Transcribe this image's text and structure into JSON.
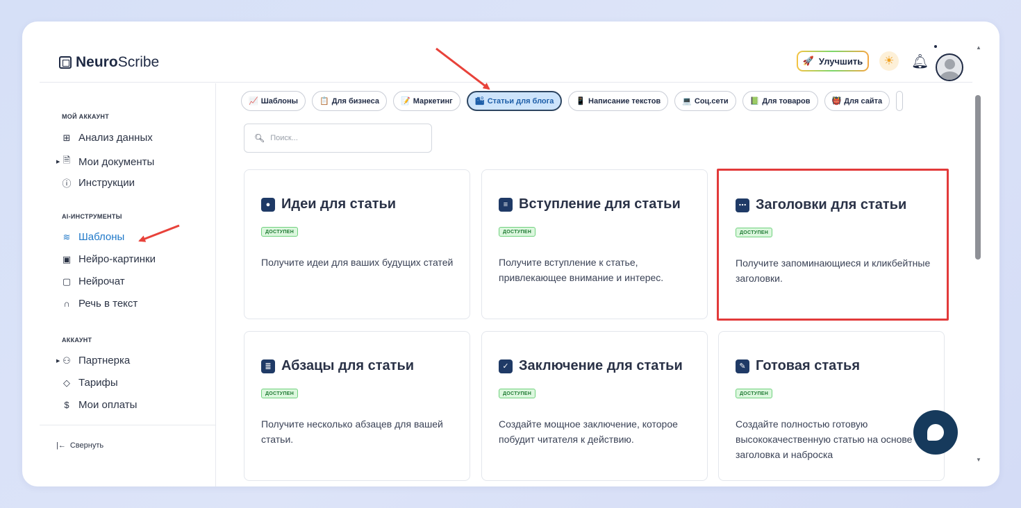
{
  "app": {
    "logo_bold": "Neuro",
    "logo_regular": "Scribe"
  },
  "header": {
    "upgrade_label": "Улучшить",
    "icons": [
      "rocket-icon",
      "sun-icon",
      "bell-icon",
      "avatar"
    ]
  },
  "sidebar": {
    "sections": [
      {
        "title": "МОЙ АККАУНТ"
      },
      {
        "title": "AI-ИНСТРУМЕНТЫ"
      },
      {
        "title": "АККАУНТ"
      }
    ],
    "items": [
      {
        "label": "Анализ данных",
        "icon": "grid-icon"
      },
      {
        "label": "Мои документы",
        "icon": "document-icon"
      },
      {
        "label": "Инструкции",
        "icon": "question-icon"
      },
      {
        "label": "Шаблоны",
        "icon": "layers-icon",
        "active": true
      },
      {
        "label": "Нейро-картинки",
        "icon": "image-icon"
      },
      {
        "label": "Нейрочат",
        "icon": "chat-icon"
      },
      {
        "label": "Речь в текст",
        "icon": "headphones-icon"
      },
      {
        "label": "Партнерка",
        "icon": "users-icon"
      },
      {
        "label": "Тарифы",
        "icon": "tag-icon"
      },
      {
        "label": "Мои оплаты",
        "icon": "dollar-icon"
      }
    ],
    "collapse_label": "Свернуть"
  },
  "categories": [
    {
      "label": "Шаблоны",
      "icon": "📈"
    },
    {
      "label": "Для бизнеса",
      "icon": "📋"
    },
    {
      "label": "Маркетинг",
      "icon": "📝"
    },
    {
      "label": "Статьи для блога",
      "icon": "🏙",
      "active": true
    },
    {
      "label": "Написание текстов",
      "icon": "📱"
    },
    {
      "label": "Соц.сети",
      "icon": "💻"
    },
    {
      "label": "Для товаров",
      "icon": "📗"
    },
    {
      "label": "Для сайта",
      "icon": "👹"
    }
  ],
  "search": {
    "placeholder": "Поиск..."
  },
  "cards": [
    {
      "title": "Идеи для статьи",
      "badge": "ДОСТУПЕН",
      "desc": "Получите идеи для ваших будущих статей",
      "icon": "speech-bubble-icon"
    },
    {
      "title": "Вступление для статьи",
      "badge": "ДОСТУПЕН",
      "desc": "Получите вступление к статье, привлекающее внимание и интерес.",
      "icon": "lines-icon"
    },
    {
      "title": "Заголовки для статьи",
      "badge": "ДОСТУПЕН",
      "desc": "Получите запоминающиеся и кликбейтные заголовки.",
      "icon": "window-icon"
    },
    {
      "title": "Абзацы для статьи",
      "badge": "ДОСТУПЕН",
      "desc": "Получите несколько абзацев для вашей статьи.",
      "icon": "notepad-icon"
    },
    {
      "title": "Заключение для статьи",
      "badge": "ДОСТУПЕН",
      "desc": "Создайте мощное заключение, которое побудит читателя к действию.",
      "icon": "checkbox-icon"
    },
    {
      "title": "Готовая статья",
      "badge": "ДОСТУПЕН",
      "desc": "Создайте полностью готовую высококачественную статью на основе заголовка и наброска",
      "icon": "pencil-icon"
    }
  ],
  "colors": {
    "accent": "#1f78c8",
    "highlight": "#e23a3a",
    "badge_bg": "#dcf7de",
    "chat_button": "#163a5c"
  }
}
